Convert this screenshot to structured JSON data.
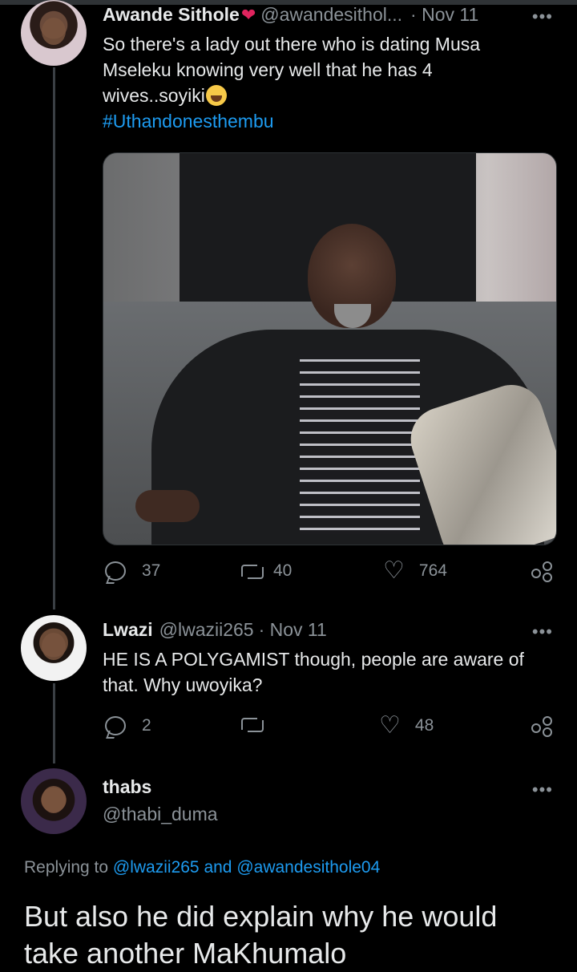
{
  "tweet1": {
    "display_name": "Awande Sithole",
    "handle": "@awandesithol...",
    "date": "· Nov 11",
    "text_line1": "So there's a lady out there who is dating Musa",
    "text_line2": "Mseleku knowing very well that he has 4",
    "text_line3": "wives..soyiki",
    "hashtag": "#Uthandonesthembu",
    "replies": "37",
    "retweets": "40",
    "likes": "764"
  },
  "tweet2": {
    "display_name": "Lwazi",
    "handle": "@lwazii265",
    "date": "· Nov 11",
    "text_line1": "HE IS A POLYGAMIST though, people are aware of",
    "text_line2": "that. Why uwoyika?",
    "replies": "2",
    "retweets": "",
    "likes": "48"
  },
  "tweet3": {
    "display_name": "thabs",
    "handle": "@thabi_duma",
    "replying_prefix": "Replying to",
    "replying_user1": "@lwazii265",
    "replying_and": "and",
    "replying_user2": "@awandesithole04",
    "text": "But also he did explain why he would take another MaKhumalo"
  },
  "more_label": "•••",
  "colors": {
    "background": "#000000",
    "text": "#e7e9ea",
    "muted": "#8b9298",
    "link": "#1d9bf0",
    "heart": "#e0245e"
  }
}
